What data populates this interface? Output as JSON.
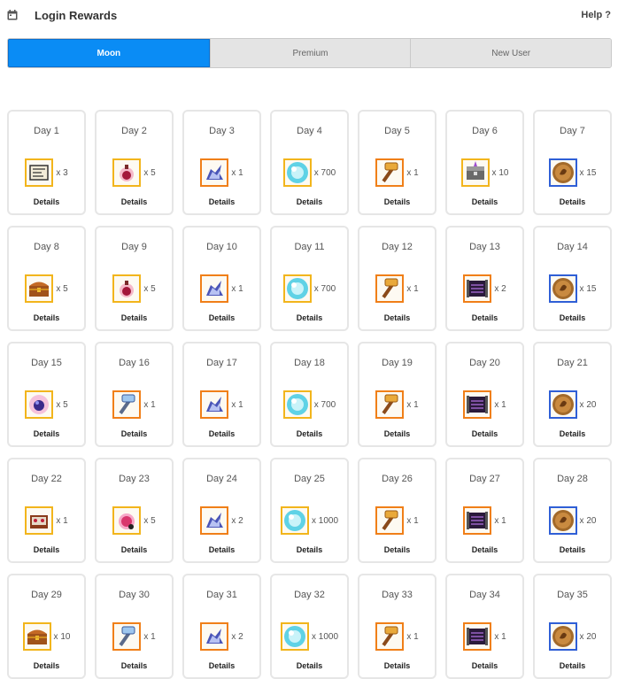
{
  "header": {
    "title": "Login Rewards",
    "help_label": "Help ?",
    "icon": "calendar-icon"
  },
  "tabs": [
    {
      "label": "Moon",
      "active": true
    },
    {
      "label": "Premium",
      "active": false
    },
    {
      "label": "New User",
      "active": false
    }
  ],
  "colors": {
    "accent": "#0a8cf5",
    "frame_gold": "#f2b51c",
    "frame_orange": "#f07f18",
    "frame_blue": "#2f5fd6"
  },
  "days": [
    {
      "label": "Day 1",
      "icon": "scroll-icon",
      "frame": "gold",
      "qty": "x 3",
      "details": "Details"
    },
    {
      "label": "Day 2",
      "icon": "potion-icon",
      "frame": "gold",
      "qty": "x 5",
      "details": "Details"
    },
    {
      "label": "Day 3",
      "icon": "pegasus-icon",
      "frame": "orange",
      "qty": "x 1",
      "details": "Details"
    },
    {
      "label": "Day 4",
      "icon": "orb-icon",
      "frame": "gold",
      "qty": "x 700",
      "details": "Details"
    },
    {
      "label": "Day 5",
      "icon": "hammer-icon",
      "frame": "orange",
      "qty": "x 1",
      "details": "Details"
    },
    {
      "label": "Day 6",
      "icon": "chest-icon",
      "frame": "gold",
      "qty": "x 10",
      "details": "Details"
    },
    {
      "label": "Day 7",
      "icon": "coin-icon",
      "frame": "blue",
      "qty": "x 15",
      "details": "Details"
    },
    {
      "label": "Day 8",
      "icon": "treasure-chest-icon",
      "frame": "gold",
      "qty": "x 5",
      "details": "Details"
    },
    {
      "label": "Day 9",
      "icon": "potion-icon",
      "frame": "gold",
      "qty": "x 5",
      "details": "Details"
    },
    {
      "label": "Day 10",
      "icon": "pegasus-icon",
      "frame": "orange",
      "qty": "x 1",
      "details": "Details"
    },
    {
      "label": "Day 11",
      "icon": "orb-icon",
      "frame": "gold",
      "qty": "x 700",
      "details": "Details"
    },
    {
      "label": "Day 12",
      "icon": "hammer-icon",
      "frame": "orange",
      "qty": "x 1",
      "details": "Details"
    },
    {
      "label": "Day 13",
      "icon": "dark-scroll-icon",
      "frame": "orange",
      "qty": "x 2",
      "details": "Details"
    },
    {
      "label": "Day 14",
      "icon": "coin-icon",
      "frame": "blue",
      "qty": "x 15",
      "details": "Details"
    },
    {
      "label": "Day 15",
      "icon": "gem-icon",
      "frame": "gold",
      "qty": "x 5",
      "details": "Details"
    },
    {
      "label": "Day 16",
      "icon": "ice-hammer-icon",
      "frame": "orange",
      "qty": "x 1",
      "details": "Details"
    },
    {
      "label": "Day 17",
      "icon": "pegasus-icon",
      "frame": "orange",
      "qty": "x 1",
      "details": "Details"
    },
    {
      "label": "Day 18",
      "icon": "orb-icon",
      "frame": "gold",
      "qty": "x 700",
      "details": "Details"
    },
    {
      "label": "Day 19",
      "icon": "hammer-icon",
      "frame": "orange",
      "qty": "x 1",
      "details": "Details"
    },
    {
      "label": "Day 20",
      "icon": "dark-scroll-icon",
      "frame": "orange",
      "qty": "x 1",
      "details": "Details"
    },
    {
      "label": "Day 21",
      "icon": "coin-icon",
      "frame": "blue",
      "qty": "x 20",
      "details": "Details"
    },
    {
      "label": "Day 22",
      "icon": "jewel-box-icon",
      "frame": "gold",
      "qty": "x 1",
      "details": "Details"
    },
    {
      "label": "Day 23",
      "icon": "pink-potion-icon",
      "frame": "gold",
      "qty": "x 5",
      "details": "Details"
    },
    {
      "label": "Day 24",
      "icon": "pegasus-icon",
      "frame": "orange",
      "qty": "x 2",
      "details": "Details"
    },
    {
      "label": "Day 25",
      "icon": "orb-icon",
      "frame": "gold",
      "qty": "x 1000",
      "details": "Details"
    },
    {
      "label": "Day 26",
      "icon": "hammer-icon",
      "frame": "orange",
      "qty": "x 1",
      "details": "Details"
    },
    {
      "label": "Day 27",
      "icon": "dark-scroll-icon",
      "frame": "orange",
      "qty": "x 1",
      "details": "Details"
    },
    {
      "label": "Day 28",
      "icon": "coin-icon",
      "frame": "blue",
      "qty": "x 20",
      "details": "Details"
    },
    {
      "label": "Day 29",
      "icon": "treasure-chest-icon",
      "frame": "gold",
      "qty": "x 10",
      "details": "Details"
    },
    {
      "label": "Day 30",
      "icon": "ice-hammer-icon",
      "frame": "orange",
      "qty": "x 1",
      "details": "Details"
    },
    {
      "label": "Day 31",
      "icon": "pegasus-icon",
      "frame": "orange",
      "qty": "x 2",
      "details": "Details"
    },
    {
      "label": "Day 32",
      "icon": "orb-icon",
      "frame": "gold",
      "qty": "x 1000",
      "details": "Details"
    },
    {
      "label": "Day 33",
      "icon": "hammer-icon",
      "frame": "orange",
      "qty": "x 1",
      "details": "Details"
    },
    {
      "label": "Day 34",
      "icon": "dark-scroll-icon",
      "frame": "orange",
      "qty": "x 1",
      "details": "Details"
    },
    {
      "label": "Day 35",
      "icon": "coin-icon",
      "frame": "blue",
      "qty": "x 20",
      "details": "Details"
    }
  ]
}
